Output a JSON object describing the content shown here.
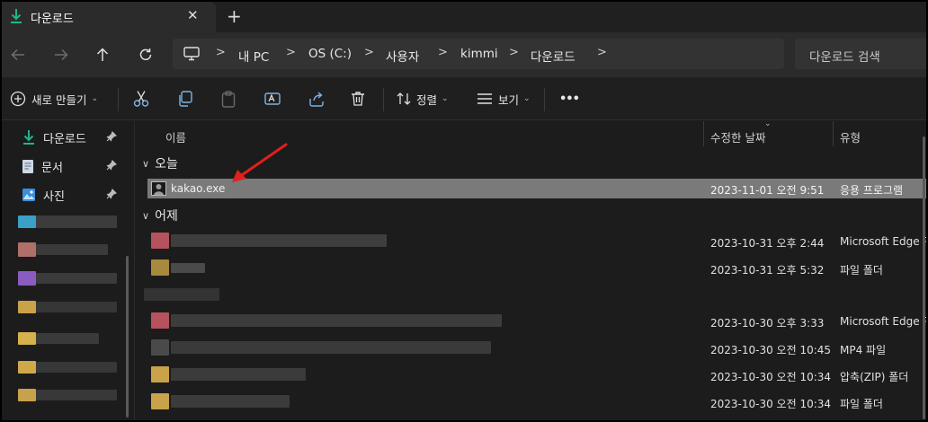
{
  "tab": {
    "title": "다운로드",
    "close": "✕",
    "new_tab": "+"
  },
  "nav": {
    "breadcrumbs": [
      "내 PC",
      "OS (C:)",
      "사용자",
      "kimmi",
      "다운로드"
    ],
    "search_placeholder": "다운로드 검색"
  },
  "toolbar": {
    "new_label": "새로 만들기",
    "sort_label": "정렬",
    "view_label": "보기",
    "more_label": "•••"
  },
  "sidebar": {
    "items": [
      {
        "label": "다운로드",
        "icon": "download-icon"
      },
      {
        "label": "문서",
        "icon": "document-icon"
      },
      {
        "label": "사진",
        "icon": "picture-icon"
      }
    ]
  },
  "columns": {
    "name": "이름",
    "modified": "수정한 날짜",
    "type": "유형"
  },
  "groups": {
    "today": "오늘",
    "yesterday": "어제"
  },
  "files": [
    {
      "name": "kakao.exe",
      "date": "2023-11-01 오전 9:51",
      "type": "응용 프로그램",
      "selected": true
    },
    {
      "name": "",
      "date": "2023-10-31 오후 2:44",
      "type": "Microsoft Edge P..."
    },
    {
      "name": "",
      "date": "2023-10-31 오후 5:32",
      "type": "파일 폴더"
    },
    {
      "name": "",
      "date": "",
      "type": ""
    },
    {
      "name": "",
      "date": "2023-10-30 오후 3:33",
      "type": "Microsoft Edge P..."
    },
    {
      "name": "",
      "date": "2023-10-30 오전 10:45",
      "type": "MP4 파일"
    },
    {
      "name": "",
      "date": "2023-10-30 오전 10:34",
      "type": "압축(ZIP) 폴더"
    },
    {
      "name": "",
      "date": "2023-10-30 오전 10:34",
      "type": "파일 폴더"
    }
  ],
  "colors": {
    "accent": "#1fb58a",
    "annotation_arrow": "#e0201b",
    "selected_row": "#7a7a7a"
  }
}
